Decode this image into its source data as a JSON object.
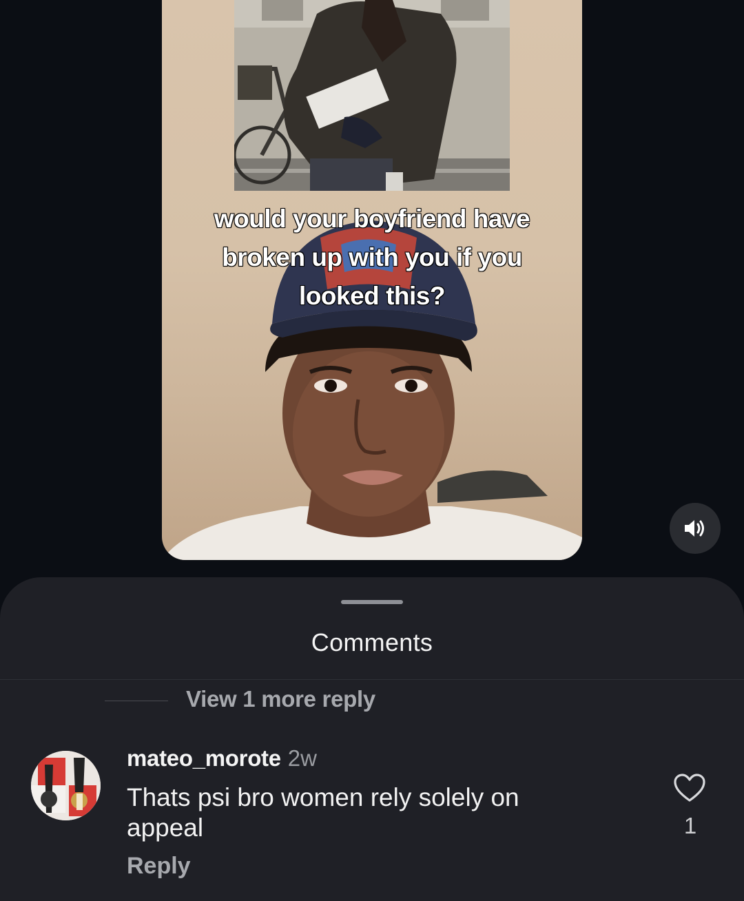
{
  "media": {
    "caption": "would your boyfriend have broken up with you if you looked this?",
    "caption_lines": [
      "would your boyfriend have",
      "broken up with you if you",
      "looked this?"
    ],
    "sound_icon": "speaker-volume-icon"
  },
  "comments_sheet": {
    "title": "Comments",
    "view_more_replies": "View 1 more reply",
    "comment": {
      "avatar_icon": "user-avatar-guitar",
      "username": "mateo_morote",
      "timestamp": "2w",
      "text": "Thats psi bro women rely solely on appeal",
      "reply_label": "Reply",
      "like_icon": "heart-outline-icon",
      "like_count": "1"
    }
  }
}
